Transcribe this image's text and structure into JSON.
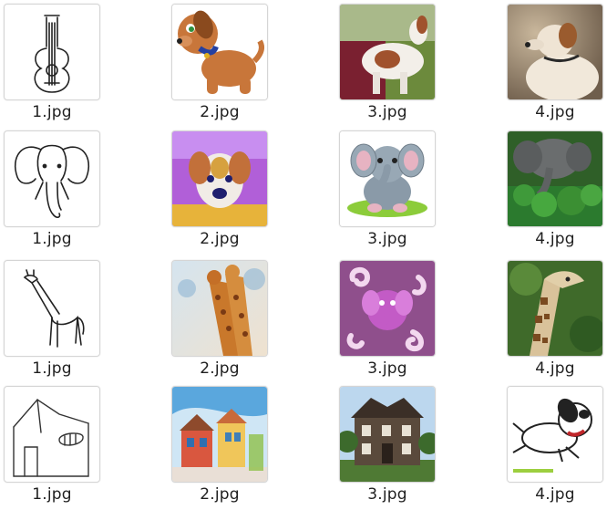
{
  "grid": {
    "rows": [
      {
        "items": [
          {
            "label": "1.jpg",
            "icon": "guitar-sketch-thumbnail"
          },
          {
            "label": "2.jpg",
            "icon": "cartoon-dog-thumbnail"
          },
          {
            "label": "3.jpg",
            "icon": "dog-photo-thumbnail"
          },
          {
            "label": "4.jpg",
            "icon": "dog-painting-thumbnail"
          }
        ]
      },
      {
        "items": [
          {
            "label": "1.jpg",
            "icon": "elephant-sketch-thumbnail"
          },
          {
            "label": "2.jpg",
            "icon": "colorful-dog-art-thumbnail"
          },
          {
            "label": "3.jpg",
            "icon": "cartoon-elephant-thumbnail"
          },
          {
            "label": "4.jpg",
            "icon": "elephant-photo-thumbnail"
          }
        ]
      },
      {
        "items": [
          {
            "label": "1.jpg",
            "icon": "giraffe-sketch-thumbnail"
          },
          {
            "label": "2.jpg",
            "icon": "giraffe-painting-thumbnail"
          },
          {
            "label": "3.jpg",
            "icon": "pink-elephant-art-thumbnail"
          },
          {
            "label": "4.jpg",
            "icon": "giraffe-photo-thumbnail"
          }
        ]
      },
      {
        "items": [
          {
            "label": "1.jpg",
            "icon": "house-sketch-thumbnail"
          },
          {
            "label": "2.jpg",
            "icon": "house-watercolor-thumbnail"
          },
          {
            "label": "3.jpg",
            "icon": "house-photo-thumbnail"
          },
          {
            "label": "4.jpg",
            "icon": "cartoon-dog-jumping-thumbnail"
          }
        ]
      }
    ]
  }
}
